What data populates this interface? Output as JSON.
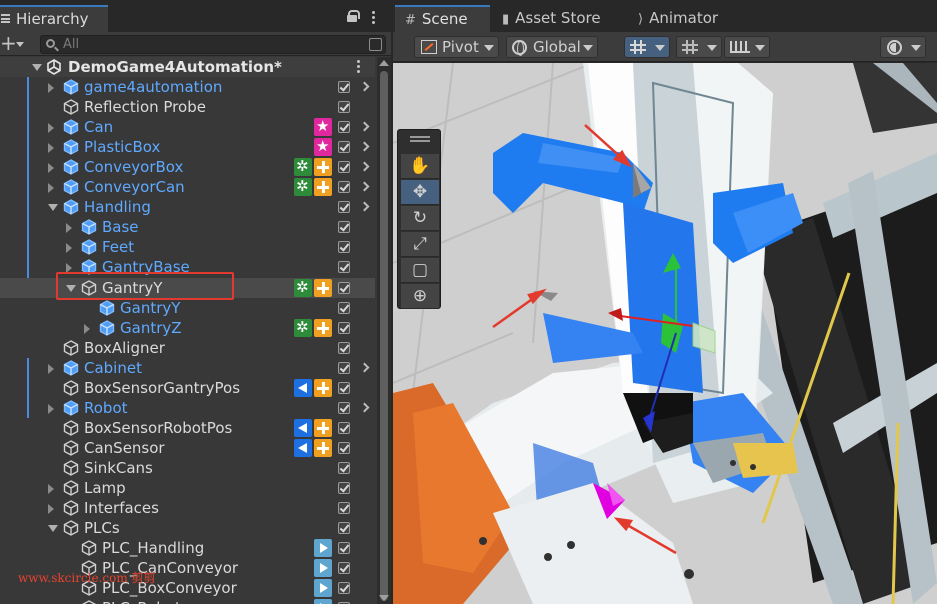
{
  "hierarchy": {
    "tab_label": "Hierarchy",
    "search_placeholder": "All",
    "scene_name": "DemoGame4Automation*",
    "rows": [
      {
        "label": "game4automation",
        "color": "blue",
        "depth": 1,
        "expand": "r",
        "check": true,
        "more": true,
        "badges": []
      },
      {
        "label": "Reflection Probe",
        "color": "white",
        "depth": 1,
        "expand": "",
        "check": true,
        "more": false,
        "badges": []
      },
      {
        "label": "Can",
        "color": "blue",
        "depth": 1,
        "expand": "r",
        "check": true,
        "more": true,
        "badges": [
          "pink"
        ]
      },
      {
        "label": "PlasticBox",
        "color": "blue",
        "depth": 1,
        "expand": "r",
        "check": true,
        "more": true,
        "badges": [
          "pink"
        ]
      },
      {
        "label": "ConveyorBox",
        "color": "blue",
        "depth": 1,
        "expand": "r",
        "check": true,
        "more": true,
        "badges": [
          "green",
          "orange"
        ]
      },
      {
        "label": "ConveyorCan",
        "color": "blue",
        "depth": 1,
        "expand": "r",
        "check": true,
        "more": true,
        "badges": [
          "green",
          "orange"
        ]
      },
      {
        "label": "Handling",
        "color": "blue",
        "depth": 1,
        "expand": "d",
        "check": true,
        "more": true,
        "badges": []
      },
      {
        "label": "Base",
        "color": "blue",
        "depth": 2,
        "expand": "r",
        "check": true,
        "more": false,
        "badges": []
      },
      {
        "label": "Feet",
        "color": "blue",
        "depth": 2,
        "expand": "r",
        "check": true,
        "more": false,
        "badges": []
      },
      {
        "label": "GantryBase",
        "color": "blue",
        "depth": 2,
        "expand": "r",
        "check": true,
        "more": false,
        "badges": []
      },
      {
        "label": "GantryY",
        "color": "white",
        "depth": 2,
        "expand": "d",
        "check": true,
        "more": false,
        "badges": [
          "green",
          "orange"
        ],
        "selected": true
      },
      {
        "label": "GantryY",
        "color": "blue",
        "depth": 3,
        "expand": "",
        "check": true,
        "more": false,
        "badges": []
      },
      {
        "label": "GantryZ",
        "color": "blue",
        "depth": 3,
        "expand": "r",
        "check": true,
        "more": false,
        "badges": [
          "green",
          "orange"
        ]
      },
      {
        "label": "BoxAligner",
        "color": "white",
        "depth": 1,
        "expand": "",
        "check": true,
        "more": false,
        "badges": []
      },
      {
        "label": "Cabinet",
        "color": "blue",
        "depth": 1,
        "expand": "r",
        "check": true,
        "more": true,
        "badges": []
      },
      {
        "label": "BoxSensorGantryPos",
        "color": "white",
        "depth": 1,
        "expand": "",
        "check": true,
        "more": false,
        "badges": [
          "bluetri",
          "orange"
        ]
      },
      {
        "label": "Robot",
        "color": "blue",
        "depth": 1,
        "expand": "r",
        "check": true,
        "more": true,
        "badges": []
      },
      {
        "label": "BoxSensorRobotPos",
        "color": "white",
        "depth": 1,
        "expand": "",
        "check": true,
        "more": false,
        "badges": [
          "bluetri",
          "orange"
        ]
      },
      {
        "label": "CanSensor",
        "color": "white",
        "depth": 1,
        "expand": "",
        "check": true,
        "more": false,
        "badges": [
          "bluetri",
          "orange"
        ]
      },
      {
        "label": "SinkCans",
        "color": "white",
        "depth": 1,
        "expand": "",
        "check": true,
        "more": false,
        "badges": []
      },
      {
        "label": "Lamp",
        "color": "white",
        "depth": 1,
        "expand": "r",
        "check": true,
        "more": false,
        "badges": []
      },
      {
        "label": "Interfaces",
        "color": "white",
        "depth": 1,
        "expand": "r",
        "check": true,
        "more": false,
        "badges": []
      },
      {
        "label": "PLCs",
        "color": "white",
        "depth": 1,
        "expand": "d",
        "check": true,
        "more": false,
        "badges": []
      },
      {
        "label": "PLC_Handling",
        "color": "white",
        "depth": 2,
        "expand": "",
        "check": true,
        "more": false,
        "badges": [
          "play"
        ]
      },
      {
        "label": "PLC_CanConveyor",
        "color": "white",
        "depth": 2,
        "expand": "",
        "check": true,
        "more": false,
        "badges": [
          "play"
        ]
      },
      {
        "label": "PLC_BoxConveyor",
        "color": "white",
        "depth": 2,
        "expand": "",
        "check": true,
        "more": false,
        "badges": [
          "play"
        ]
      },
      {
        "label": "PLC_Robot",
        "color": "white",
        "depth": 2,
        "expand": "",
        "check": true,
        "more": false,
        "badges": [
          "play"
        ]
      }
    ]
  },
  "scene_tabs": [
    {
      "label": "Scene",
      "icon": "grid-icon",
      "active": true
    },
    {
      "label": "Asset Store",
      "icon": "shopping-bag-icon",
      "active": false
    },
    {
      "label": "Animator",
      "icon": "animator-icon",
      "active": false
    }
  ],
  "toolbar": {
    "pivot_label": "Pivot",
    "global_label": "Global"
  },
  "tools": [
    "hand-tool",
    "move-tool",
    "rotate-tool",
    "scale-tool",
    "rect-tool",
    "transform-tool"
  ],
  "watermark": "www.skcircle.com 剪剪",
  "colors": {
    "accent": "#3a79bb",
    "selection_outline": "#e33a2f",
    "blue_label": "#5fa9ff",
    "part_blue": "#1f7bf0"
  }
}
